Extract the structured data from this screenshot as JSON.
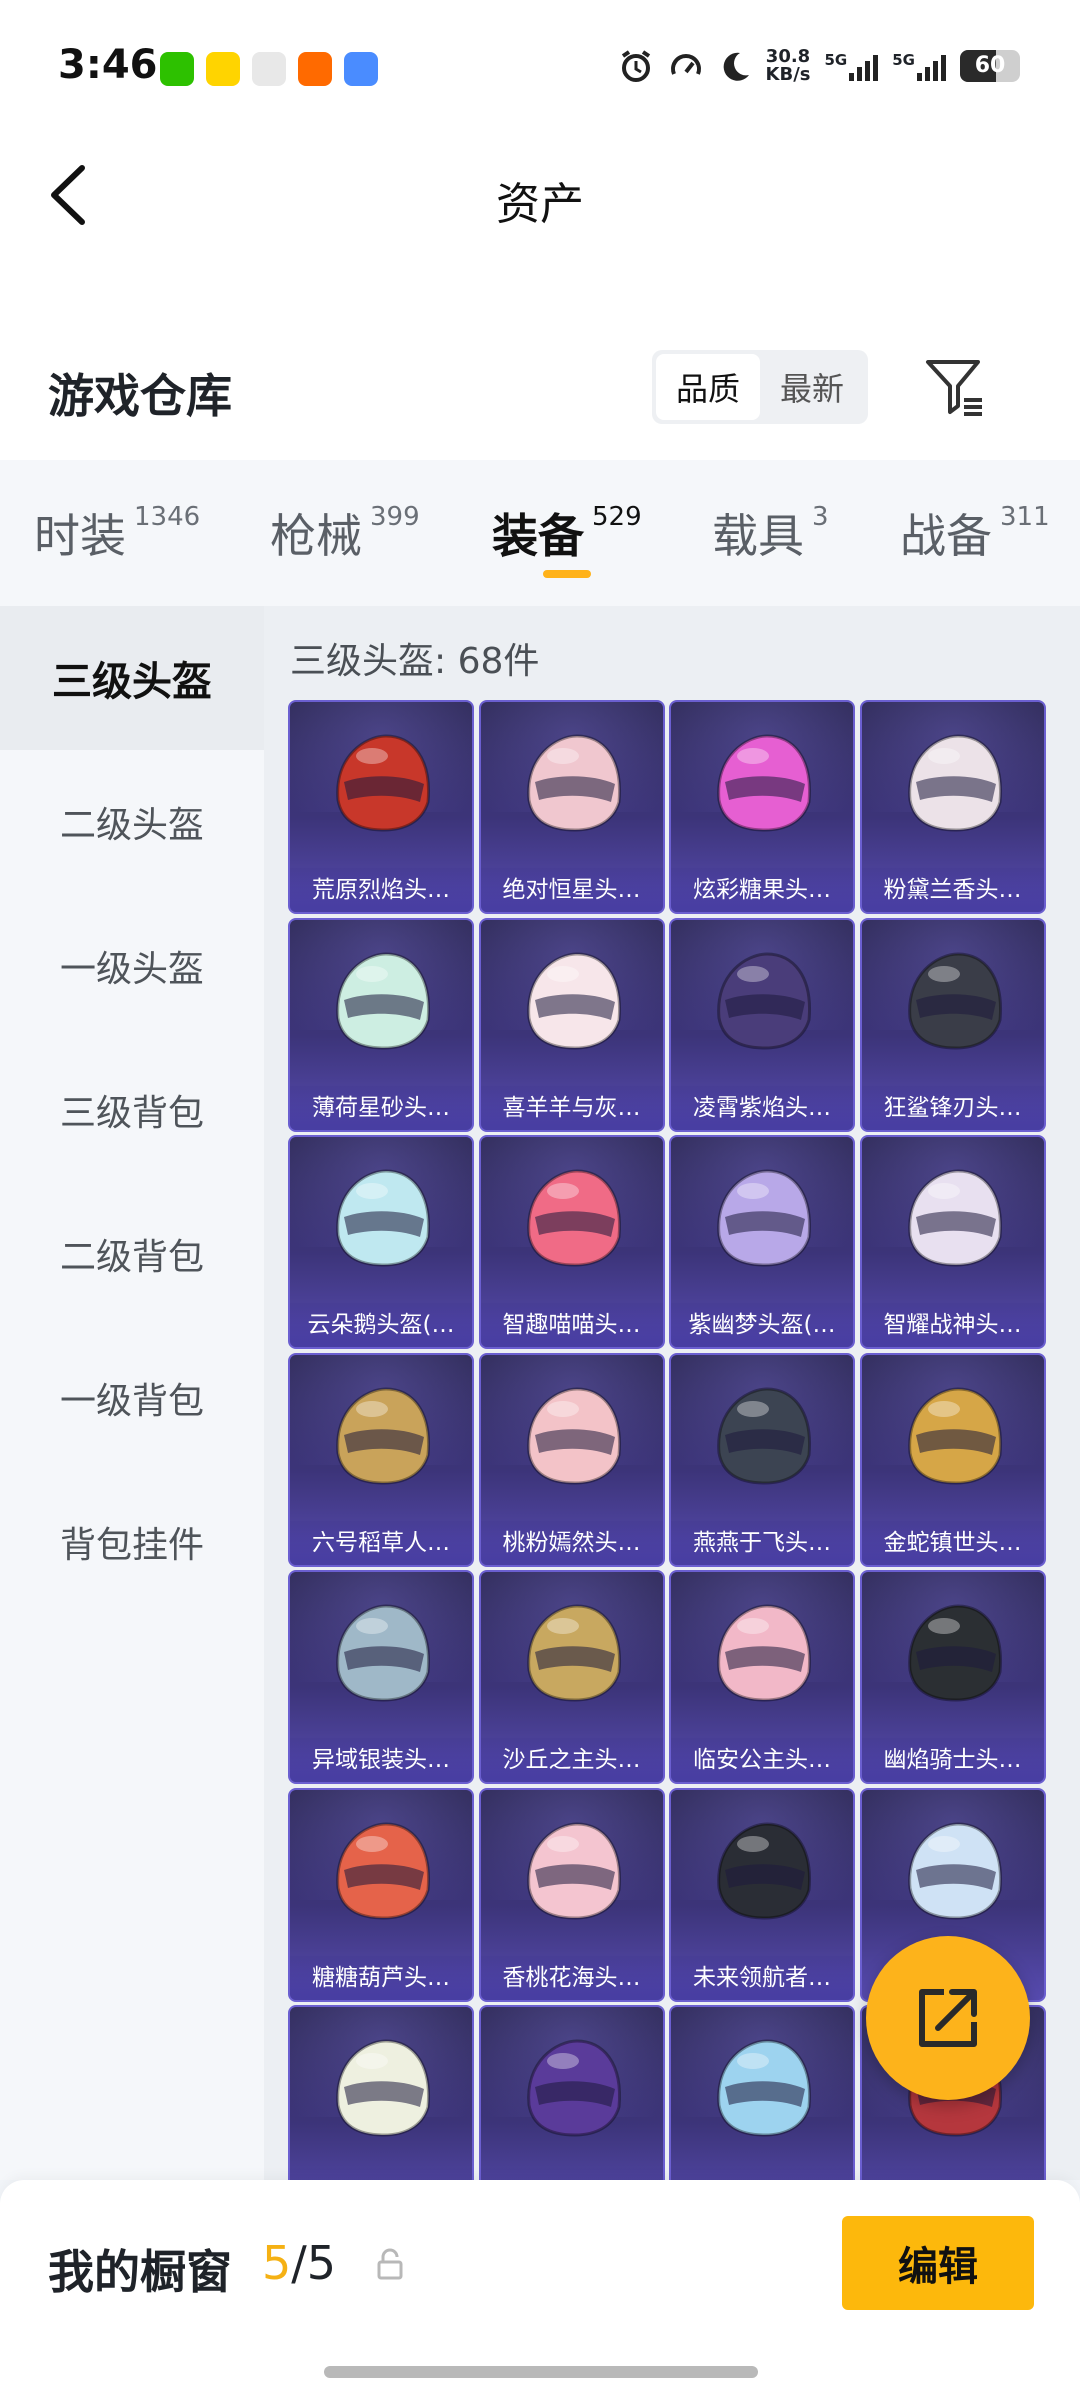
{
  "status_bar": {
    "time": "3:46",
    "net_speed_value": "30.8",
    "net_speed_unit": "KB/s",
    "sim1": "5G",
    "sim2": "5G",
    "battery": "60",
    "battery_level": 0.6,
    "notification_icons": [
      {
        "name": "wechat-icon",
        "color": "#2dc100"
      },
      {
        "name": "news-app-icon",
        "color": "#ffd400"
      },
      {
        "name": "sync-app-icon",
        "color": "#e8e8e8"
      },
      {
        "name": "taobao-icon",
        "color": "#ff6a00"
      },
      {
        "name": "app-icon",
        "color": "#4a8cff"
      }
    ]
  },
  "header": {
    "title": "资产"
  },
  "section": {
    "title": "游戏仓库",
    "sort_options": [
      "品质",
      "最新"
    ],
    "active_sort": "品质"
  },
  "tabs": [
    {
      "label": "时装",
      "count": "1346"
    },
    {
      "label": "枪械",
      "count": "399"
    },
    {
      "label": "装备",
      "count": "529",
      "active": true
    },
    {
      "label": "载具",
      "count": "3"
    },
    {
      "label": "战备",
      "count": "311"
    }
  ],
  "sidebar": {
    "items": [
      "三级头盔",
      "二级头盔",
      "一级头盔",
      "三级背包",
      "二级背包",
      "一级背包",
      "背包挂件"
    ],
    "active": "三级头盔"
  },
  "content": {
    "count_label": "三级头盔: 68件",
    "items": [
      {
        "name": "荒原烈焰头…",
        "color": "#c8372a"
      },
      {
        "name": "绝对恒星头…",
        "color": "#f0c7cf"
      },
      {
        "name": "炫彩糖果头…",
        "color": "#e65fd2"
      },
      {
        "name": "粉黛兰香头…",
        "color": "#ece2e8"
      },
      {
        "name": "薄荷星砂头…",
        "color": "#cdeee2"
      },
      {
        "name": "喜羊羊与灰…",
        "color": "#f7e6ea"
      },
      {
        "name": "凌霄紫焰头…",
        "color": "#4a3d7a"
      },
      {
        "name": "狂鲨锋刃头…",
        "color": "#3a3d48"
      },
      {
        "name": "云朵鹅头盔(…",
        "color": "#bfe8f0"
      },
      {
        "name": "智趣喵喵头…",
        "color": "#f06b86"
      },
      {
        "name": "紫幽梦头盔(…",
        "color": "#b8a8e8"
      },
      {
        "name": "智耀战神头…",
        "color": "#e8e0f0"
      },
      {
        "name": "六号稻草人…",
        "color": "#c9a35a"
      },
      {
        "name": "桃粉嫣然头…",
        "color": "#f3c3c8"
      },
      {
        "name": "燕燕于飞头…",
        "color": "#3c4452"
      },
      {
        "name": "金蛇镇世头…",
        "color": "#d6a647"
      },
      {
        "name": "异域银装头…",
        "color": "#9fb8c8"
      },
      {
        "name": "沙丘之主头…",
        "color": "#c8a860"
      },
      {
        "name": "临安公主头…",
        "color": "#f2b8c8"
      },
      {
        "name": "幽焰骑士头…",
        "color": "#2b2f33"
      },
      {
        "name": "糖糖葫芦头…",
        "color": "#e5634a"
      },
      {
        "name": "香桃花海头…",
        "color": "#f4c5d0"
      },
      {
        "name": "未来领航者…",
        "color": "#2a2d35"
      },
      {
        "name": "",
        "color": "#cfe2f5"
      },
      {
        "name": "",
        "color": "#eef0e0"
      },
      {
        "name": "",
        "color": "#5a3b9a"
      },
      {
        "name": "",
        "color": "#9dd3ef"
      },
      {
        "name": "",
        "color": "#b5373d"
      }
    ]
  },
  "bottom_bar": {
    "label": "我的橱窗",
    "count_current": "5",
    "count_sep_total": "/5",
    "edit_label": "编辑"
  },
  "colors": {
    "accent": "#fdb80c",
    "card_border": "#6b5fd0"
  }
}
